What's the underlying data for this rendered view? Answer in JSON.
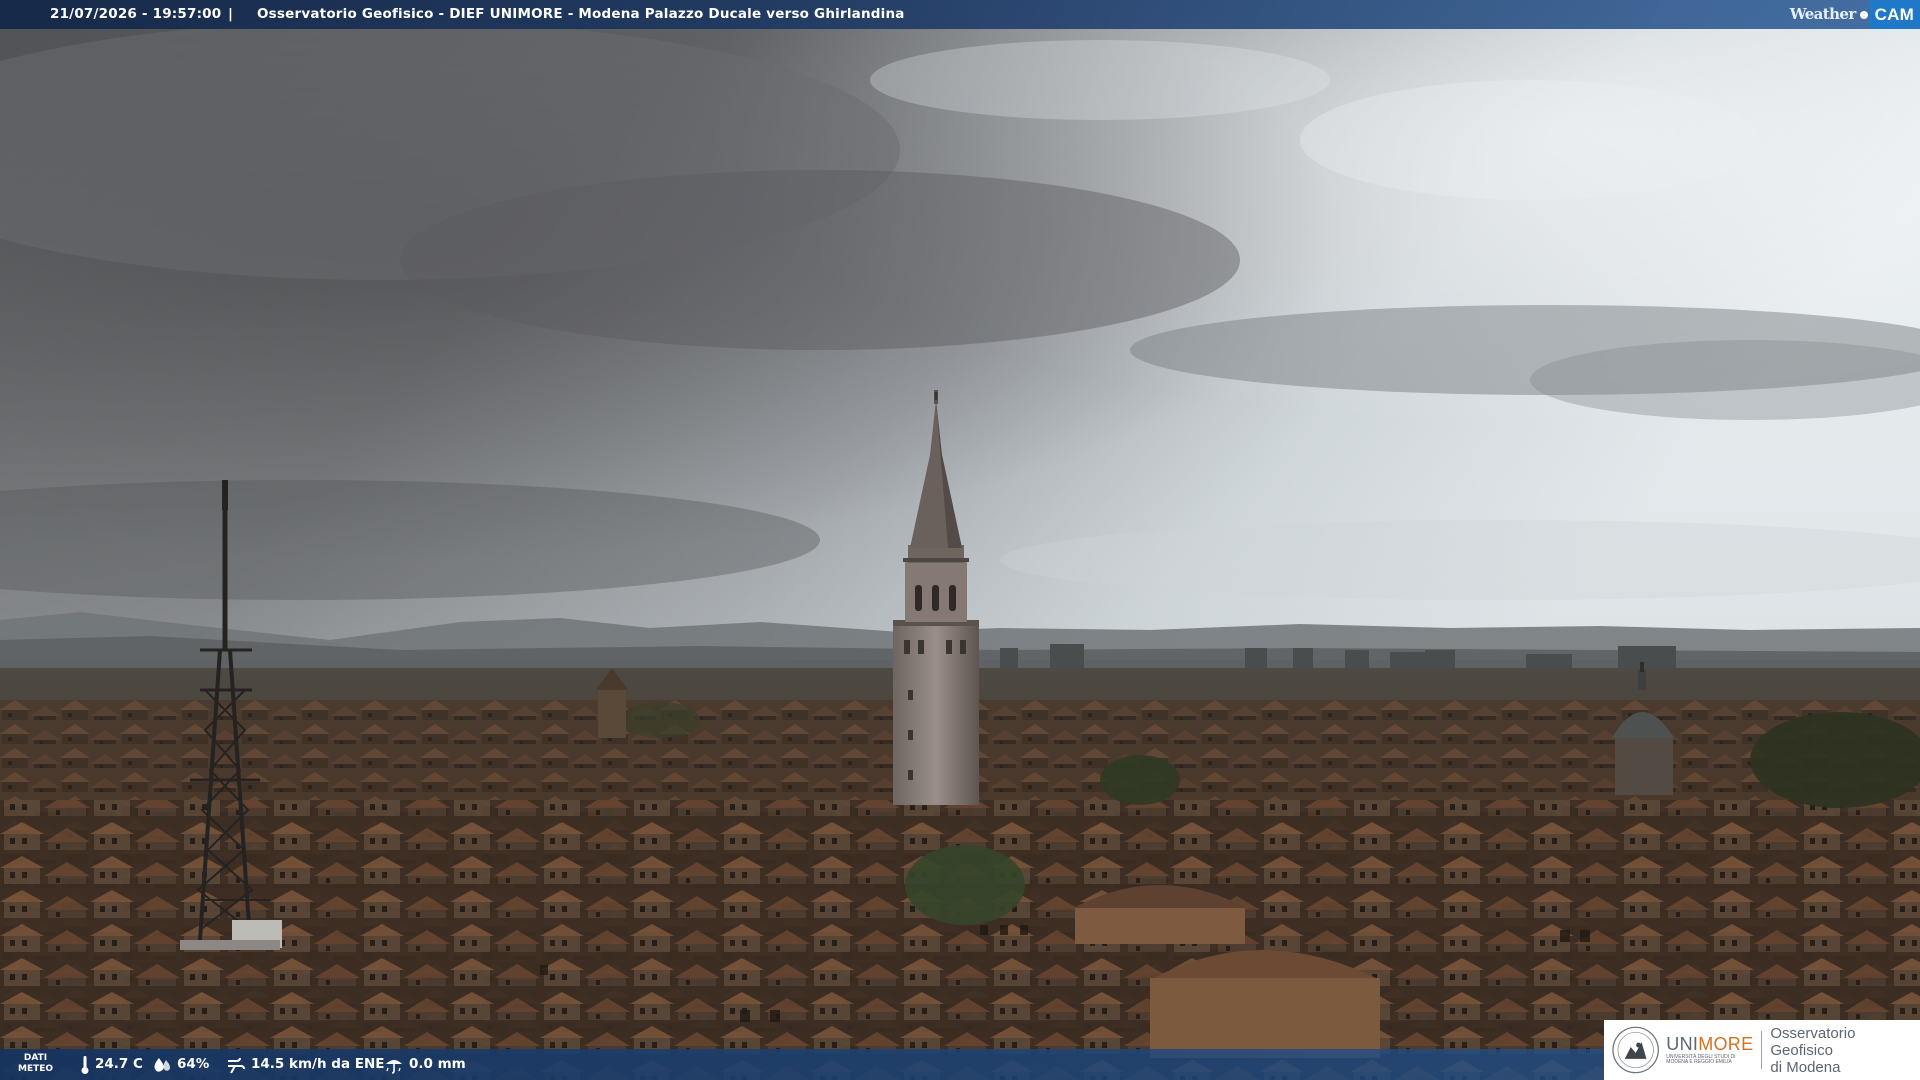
{
  "overlay": {
    "timestamp": "21/07/2026 - 19:57:00",
    "separator": "|",
    "caption": "Osservatorio Geofisico - DIEF UNIMORE - Modena Palazzo Ducale verso Ghirlandina",
    "logo_weather": "Weather",
    "logo_cam": "CAM"
  },
  "meteo": {
    "label_line1": "DATI",
    "label_line2": "METEO",
    "temperature": "24.7 C",
    "humidity": "64%",
    "wind": "14.5 km/h da ENE",
    "rain": "0.0 mm"
  },
  "badge": {
    "uni": "UNI",
    "more": "MORE",
    "uni_sub": "UNIVERSITÀ DEGLI STUDI DI MODENA E REGGIO EMILIA",
    "observatory_line1": "Osservatorio Geofisico",
    "observatory_line2": "di Modena"
  },
  "colors": {
    "sky_dark": "#5a5c5f",
    "sky_light": "#dfe6ea",
    "roof": "#6b4a34",
    "bar_blue": "#1f3f72",
    "cam_blue": "#1f78c8",
    "unimore_orange": "#d4711f"
  },
  "icons": {
    "temperature": "thermometer-icon",
    "humidity": "water-drop-icon",
    "wind": "wind-icon",
    "rain": "rain-gauge-icon"
  }
}
